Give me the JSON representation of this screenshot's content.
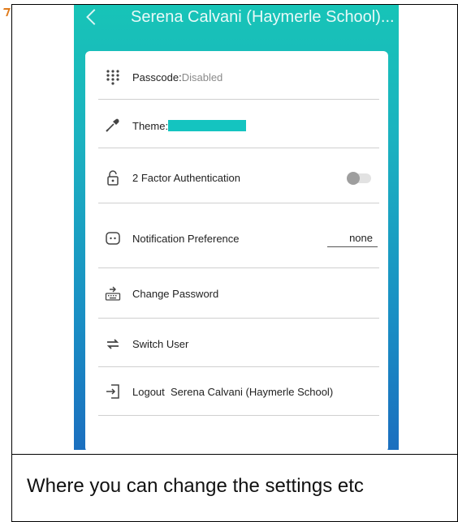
{
  "app_bar": {
    "title": "Serena Calvani (Haymerle School)..."
  },
  "settings": {
    "passcode": {
      "label": "Passcode:",
      "value": "Disabled"
    },
    "theme": {
      "label": "Theme:",
      "color": "#14c4c0"
    },
    "two_factor": {
      "label": "2 Factor Authentication",
      "enabled": false
    },
    "notification": {
      "label": "Notification Preference",
      "value": "none"
    },
    "change_password": {
      "label": "Change Password"
    },
    "switch_user": {
      "label": "Switch User"
    },
    "logout": {
      "label": "Logout",
      "user": "Serena Calvani (Haymerle School)"
    }
  },
  "caption": "Where you can change the settings etc",
  "colors": {
    "gradient_top": "#17c4b7",
    "gradient_bottom": "#1b6fbf",
    "theme_swatch": "#14c4c0"
  },
  "icons": [
    "back-icon",
    "keypad-icon",
    "eyedropper-icon",
    "lock-icon",
    "chat-icon",
    "keyboard-icon",
    "swap-icon",
    "logout-icon"
  ]
}
